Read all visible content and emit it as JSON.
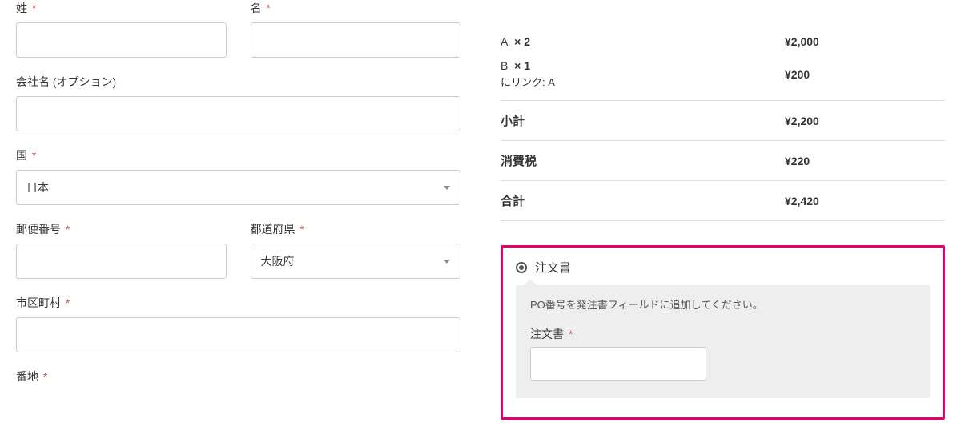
{
  "form": {
    "lastname_label": "姓",
    "firstname_label": "名",
    "company_label": "会社名 (オプション)",
    "country_label": "国",
    "country_value": "日本",
    "postcode_label": "郵便番号",
    "prefecture_label": "都道府県",
    "prefecture_value": "大阪府",
    "city_label": "市区町村",
    "address_label": "番地"
  },
  "summary": {
    "items": [
      {
        "name": "A",
        "qty": "× 2",
        "price": "¥2,000",
        "link": ""
      },
      {
        "name": "B",
        "qty": "× 1",
        "price": "¥200",
        "link": "にリンク: A"
      }
    ],
    "subtotal_label": "小計",
    "subtotal_value": "¥2,200",
    "tax_label": "消費税",
    "tax_value": "¥220",
    "total_label": "合計",
    "total_value": "¥2,420"
  },
  "payment": {
    "method_label": "注文書",
    "instruction": "PO番号を発注書フィールドに追加してください。",
    "po_label": "注文書"
  }
}
